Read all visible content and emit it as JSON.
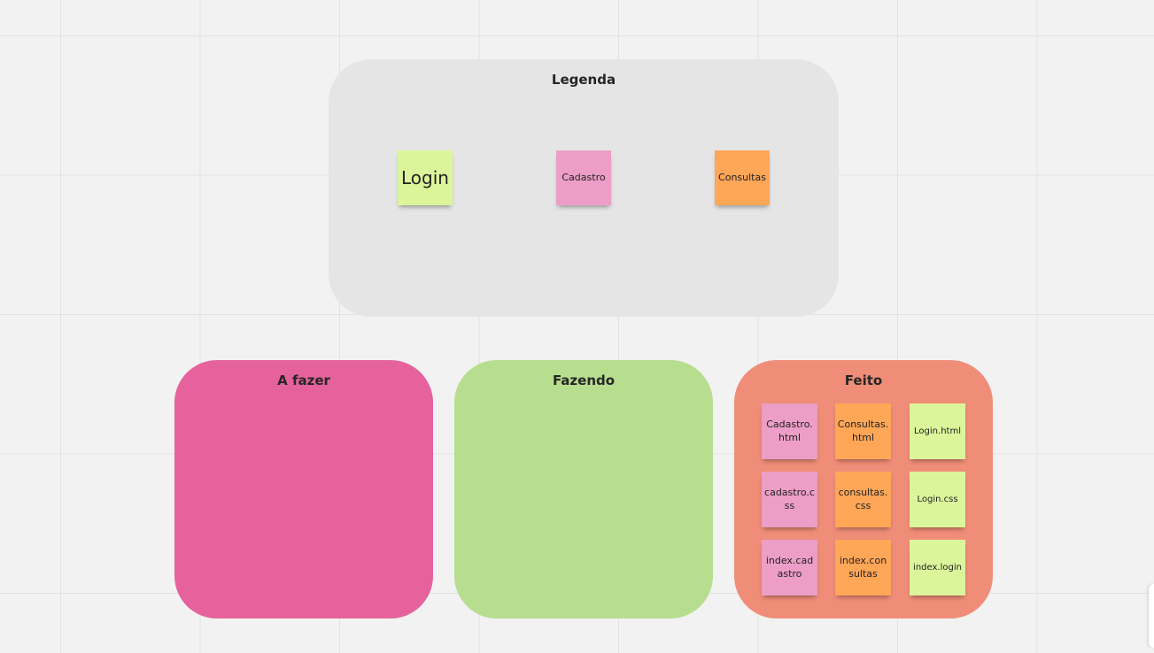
{
  "board": {
    "legend": {
      "title": "Legenda",
      "items": [
        {
          "label": "Login",
          "color": "#dbf69a"
        },
        {
          "label": "Cadastro",
          "color": "#ec9ec6"
        },
        {
          "label": "Consultas",
          "color": "#ffa657"
        }
      ]
    },
    "columns": [
      {
        "title": "A fazer",
        "color": "#e5629c"
      },
      {
        "title": "Fazendo",
        "color": "#b7dd8e"
      },
      {
        "title": "Feito",
        "color": "#f08d78"
      }
    ],
    "done_cards": [
      {
        "label": "Cadastro.html",
        "color": "#ec9ec6"
      },
      {
        "label": "Consultas.html",
        "color": "#ffa657"
      },
      {
        "label": "Login.html",
        "color": "#dbf69a"
      },
      {
        "label": "cadastro.css",
        "color": "#ec9ec6"
      },
      {
        "label": "consultas.css",
        "color": "#ffa657"
      },
      {
        "label": "Login.css",
        "color": "#dbf69a"
      },
      {
        "label": "index.cadastro",
        "color": "#ec9ec6"
      },
      {
        "label": "index.consultas",
        "color": "#ffa657"
      },
      {
        "label": "index.login",
        "color": "#dbf69a"
      }
    ]
  }
}
